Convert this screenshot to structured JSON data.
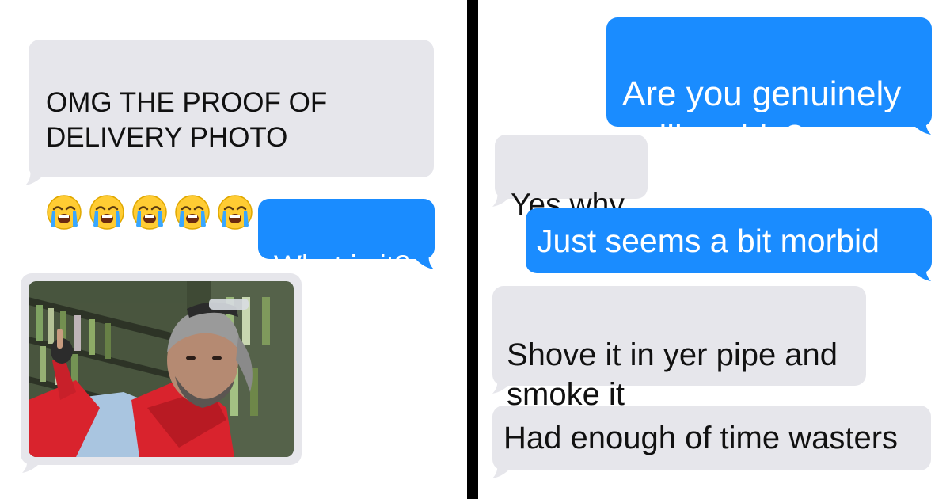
{
  "colors": {
    "incoming_bubble": "#e6e6eb",
    "outgoing_bubble": "#1a8cff",
    "divider": "#000000",
    "background": "#ffffff"
  },
  "left_panel": {
    "msg_1": {
      "sender": "incoming",
      "text": "OMG THE PROOF OF\nDELIVERY PHOTO",
      "emojis": [
        "loudly-crying-face",
        "loudly-crying-face",
        "loudly-crying-face",
        "loudly-crying-face",
        "loudly-crying-face"
      ]
    },
    "msg_2": {
      "sender": "outgoing",
      "text": "What is it?"
    },
    "msg_3": {
      "sender": "incoming",
      "attachment": "photo of a man in a red jacket with sunglasses on his head, pointing at the camera"
    }
  },
  "right_panel": {
    "msg_1": {
      "sender": "outgoing",
      "text": "Are you genuinely\nselling this?"
    },
    "msg_2": {
      "sender": "incoming",
      "text": "Yes why"
    },
    "msg_3": {
      "sender": "outgoing",
      "text": "Just seems a bit morbid"
    },
    "msg_4": {
      "sender": "incoming",
      "text": "Shove it in yer pipe and\nsmoke it"
    },
    "msg_5": {
      "sender": "incoming",
      "text": "Had enough of time wasters"
    }
  }
}
